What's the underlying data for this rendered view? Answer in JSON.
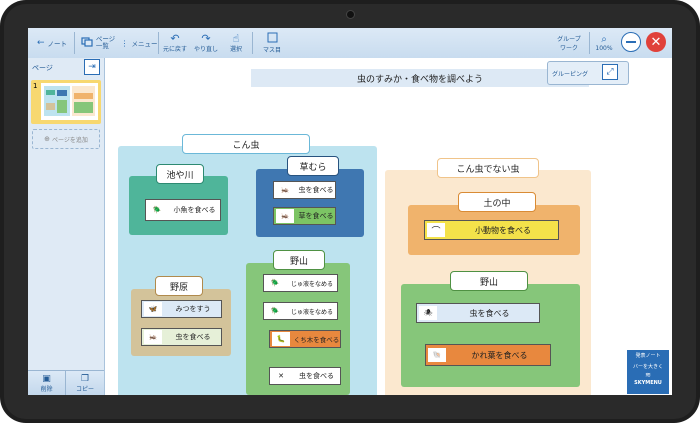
{
  "toolbar": {
    "note_label": "ノート",
    "page_list_label_1": "ページ",
    "page_list_label_2": "一覧",
    "menu_label": "メニュー",
    "undo_label": "元に戻す",
    "redo_label": "やり直し",
    "select_label": "選択",
    "grid_label": "マス目",
    "group_work_label_1": "グループ",
    "group_work_label_2": "ワーク",
    "zoom_label": "100%"
  },
  "sidebar": {
    "header": "ページ",
    "page_number": "1",
    "add_page_label": "ページを追加",
    "delete_label": "削除",
    "copy_label": "コピー"
  },
  "canvas": {
    "title": "虫のすみか・食べ物を調べよう",
    "grouping_label": "グルーピング",
    "insects_label": "こん虫",
    "non_insects_label": "こん虫でない虫",
    "groups": {
      "pond": "池や川",
      "grass": "草むら",
      "field": "野原",
      "mountain": "野山",
      "soil": "土の中",
      "mountain2": "野山"
    },
    "cards": {
      "pond_1": "小魚を食べる",
      "grass_1": "虫を食べる",
      "grass_2": "草を食べる",
      "field_1": "みつをすう",
      "field_2": "虫を食べる",
      "mtn_1": "じゅ液をなめる",
      "mtn_2": "じゅ液をなめる",
      "mtn_3": "くち木を食べる",
      "mtn_4": "虫を食べる",
      "soil_1": "小動物を食べる",
      "mtn2_1": "虫を食べる",
      "mtn2_2": "かれ葉を食べる"
    }
  },
  "brand": {
    "line1": "発表ノート",
    "line2": "バーを大きく",
    "name": "SKYMENU"
  },
  "colors": {
    "toolbar_blue": "#2a6db5",
    "insect_panel": "#bde3ef",
    "non_insect_panel": "#fbe8cf",
    "pond_green": "#4fb59a",
    "grass_blue": "#3f77b1",
    "field_tan": "#d3c39a",
    "mountain_green": "#86c67a",
    "soil_orange": "#f0b36c",
    "close_red": "#e0413a"
  }
}
